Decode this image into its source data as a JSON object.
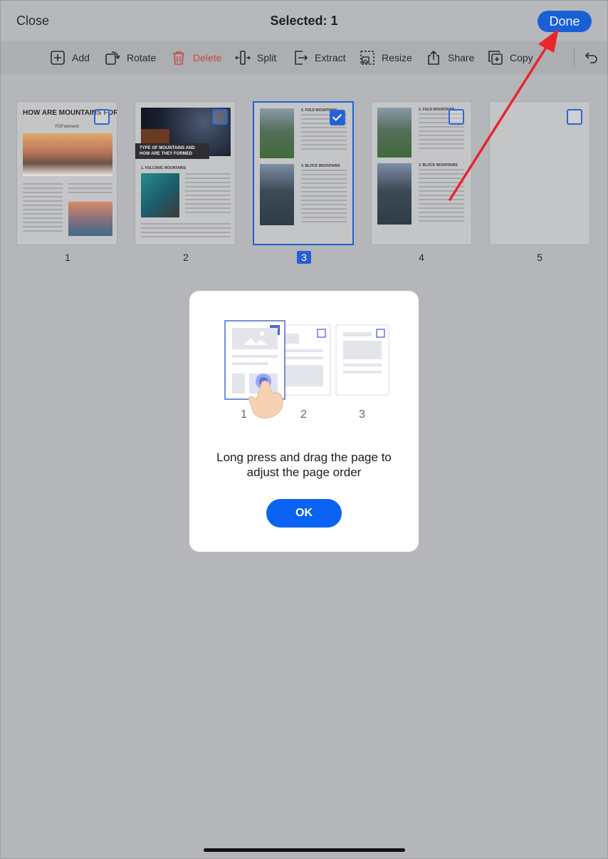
{
  "header": {
    "close_label": "Close",
    "title": "Selected: 1",
    "done_label": "Done"
  },
  "toolbar": {
    "items": [
      {
        "label": "Add",
        "icon": "add-page-icon"
      },
      {
        "label": "Rotate",
        "icon": "rotate-icon"
      },
      {
        "label": "Delete",
        "icon": "trash-icon"
      },
      {
        "label": "Split",
        "icon": "split-icon"
      },
      {
        "label": "Extract",
        "icon": "extract-icon"
      },
      {
        "label": "Resize",
        "icon": "resize-icon"
      },
      {
        "label": "Share",
        "icon": "share-icon"
      },
      {
        "label": "Copy",
        "icon": "copy-icon"
      }
    ],
    "undo_icon": "undo-icon"
  },
  "pages": [
    {
      "number": "1",
      "selected": false,
      "heading": "HOW ARE MOUNTAINS FORMED",
      "subheading": "PDFelement"
    },
    {
      "number": "2",
      "selected": false,
      "heading": "TYPE OF MOUNTAINS AND HOW ARE THEY FORMED",
      "subheading": "1. VOLCANIC MOUNTAINS"
    },
    {
      "number": "3",
      "selected": true,
      "heading": "2. FOLD MOUNTAINS",
      "subheading": "3. BLOCK MOUNTAINS"
    },
    {
      "number": "4",
      "selected": false,
      "heading": "2. FOLD MOUNTAINS",
      "subheading": "3. BLOCK MOUNTAINS"
    },
    {
      "number": "5",
      "selected": false,
      "heading": "",
      "subheading": ""
    }
  ],
  "modal": {
    "illustration_numbers": [
      "1",
      "2",
      "3"
    ],
    "message_line1": "Long press and drag the page to",
    "message_line2": "adjust the page order",
    "ok_label": "OK"
  },
  "colors": {
    "accent": "#1a5fd6",
    "delete": "#c94841",
    "arrow": "#e8262e",
    "modal_button": "#0a63f3"
  }
}
